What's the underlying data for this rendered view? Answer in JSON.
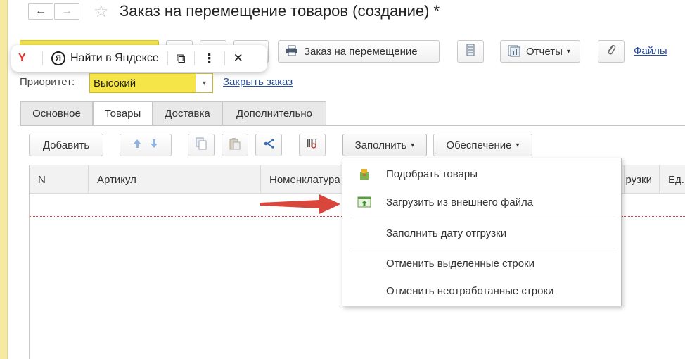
{
  "window": {
    "title": "Заказ на перемещение товаров (создание) *",
    "nav_back": "←",
    "nav_forward": "→",
    "star": "☆"
  },
  "toolbar": {
    "print_order_label": "Заказ на перемещение",
    "reports_label": "Отчеты",
    "files_link": "Файлы"
  },
  "yandex_popup": {
    "search_label": "Найти в Яндексе",
    "logo_letter": "Y",
    "badge_letter": "Я",
    "copy_glyph": "⧉",
    "more_glyph": "⋮",
    "close_glyph": "✕"
  },
  "priority": {
    "label": "Приоритет:",
    "value": "Высокий",
    "close_order_link": "Закрыть заказ"
  },
  "tabs": [
    {
      "label": "Основное"
    },
    {
      "label": "Товары"
    },
    {
      "label": "Доставка"
    },
    {
      "label": "Дополнительно"
    }
  ],
  "goods_toolbar": {
    "add_label": "Добавить",
    "fill_label": "Заполнить",
    "supply_label": "Обеспечение"
  },
  "table": {
    "columns": [
      "N",
      "Артикул",
      "Номенклатура",
      "рузки",
      "Ед."
    ]
  },
  "fill_menu": {
    "items": [
      {
        "label": "Подобрать товары",
        "icon": "pick-goods-icon"
      },
      {
        "label": "Загрузить из внешнего файла",
        "icon": "load-file-icon"
      },
      {
        "label": "Заполнить дату отгрузки",
        "icon": ""
      },
      {
        "label": "Отменить выделенные строки",
        "icon": ""
      },
      {
        "label": "Отменить неотработанные строки",
        "icon": ""
      }
    ]
  },
  "colors": {
    "accent_yellow": "#f6e548",
    "link_blue": "#2a4f9e",
    "arrow_red": "#d9463b"
  }
}
